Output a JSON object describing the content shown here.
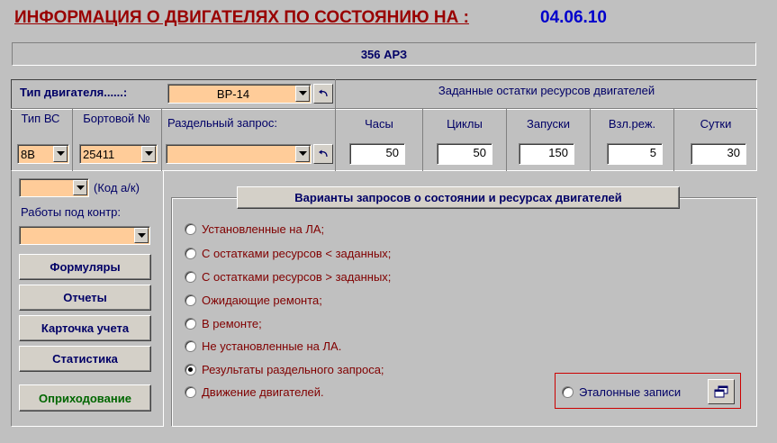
{
  "header": {
    "title": "ИНФОРМАЦИЯ О ДВИГАТЕЛЯХ ПО СОСТОЯНИЮ НА :",
    "date": "04.06.10"
  },
  "banner": {
    "text": "356 АРЗ"
  },
  "engine_type": {
    "label": "Тип двигателя......:",
    "value": "ВР-14"
  },
  "reserves": {
    "title": "Заданные остатки ресурсов двигателей",
    "columns": [
      {
        "label": "Часы",
        "value": "50"
      },
      {
        "label": "Циклы",
        "value": "50"
      },
      {
        "label": "Запуски",
        "value": "150"
      },
      {
        "label": "Взл.реж.",
        "value": "5"
      },
      {
        "label": "Сутки",
        "value": "30"
      }
    ]
  },
  "aircraft": {
    "type_label": "Тип ВС",
    "type_value": "8В",
    "board_label": "Бортовой №",
    "board_value": "25411"
  },
  "separate_query": {
    "label": "Раздельный запрос:",
    "value": ""
  },
  "left_panel": {
    "code_value": "",
    "code_label": "(Код а/к)",
    "works_label": "Работы под контр:",
    "works_value": "",
    "buttons": {
      "forms": "Формуляры",
      "reports": "Отчеты",
      "card": "Карточка учета",
      "stats": "Статистика",
      "receipt": "Оприходование"
    }
  },
  "query_group": {
    "title": "Варианты запросов о состоянии и ресурсах двигателей",
    "options": [
      {
        "label": "Установленные на ЛА;",
        "selected": false
      },
      {
        "label": "С остатками ресурсов < заданных;",
        "selected": false
      },
      {
        "label": "С остатками ресурсов > заданных;",
        "selected": false
      },
      {
        "label": "Ожидающие ремонта;",
        "selected": false
      },
      {
        "label": "В ремонте;",
        "selected": false
      },
      {
        "label": "Не установленные на ЛА.",
        "selected": false
      },
      {
        "label": "Результаты раздельного запроса;",
        "selected": true
      },
      {
        "label": "Движение двигателей.",
        "selected": false
      }
    ],
    "reference": {
      "label": "Эталонные записи",
      "selected": false
    }
  },
  "colors": {
    "title": "#990000",
    "date": "#0000cc",
    "navy": "#000066",
    "option_text": "#800000",
    "combo_bg": "#ffcc99",
    "green_button": "#006600",
    "highlight_border": "#cc0000"
  },
  "icons": [
    "chevron-down-icon",
    "undo-icon",
    "window-copy-icon"
  ]
}
